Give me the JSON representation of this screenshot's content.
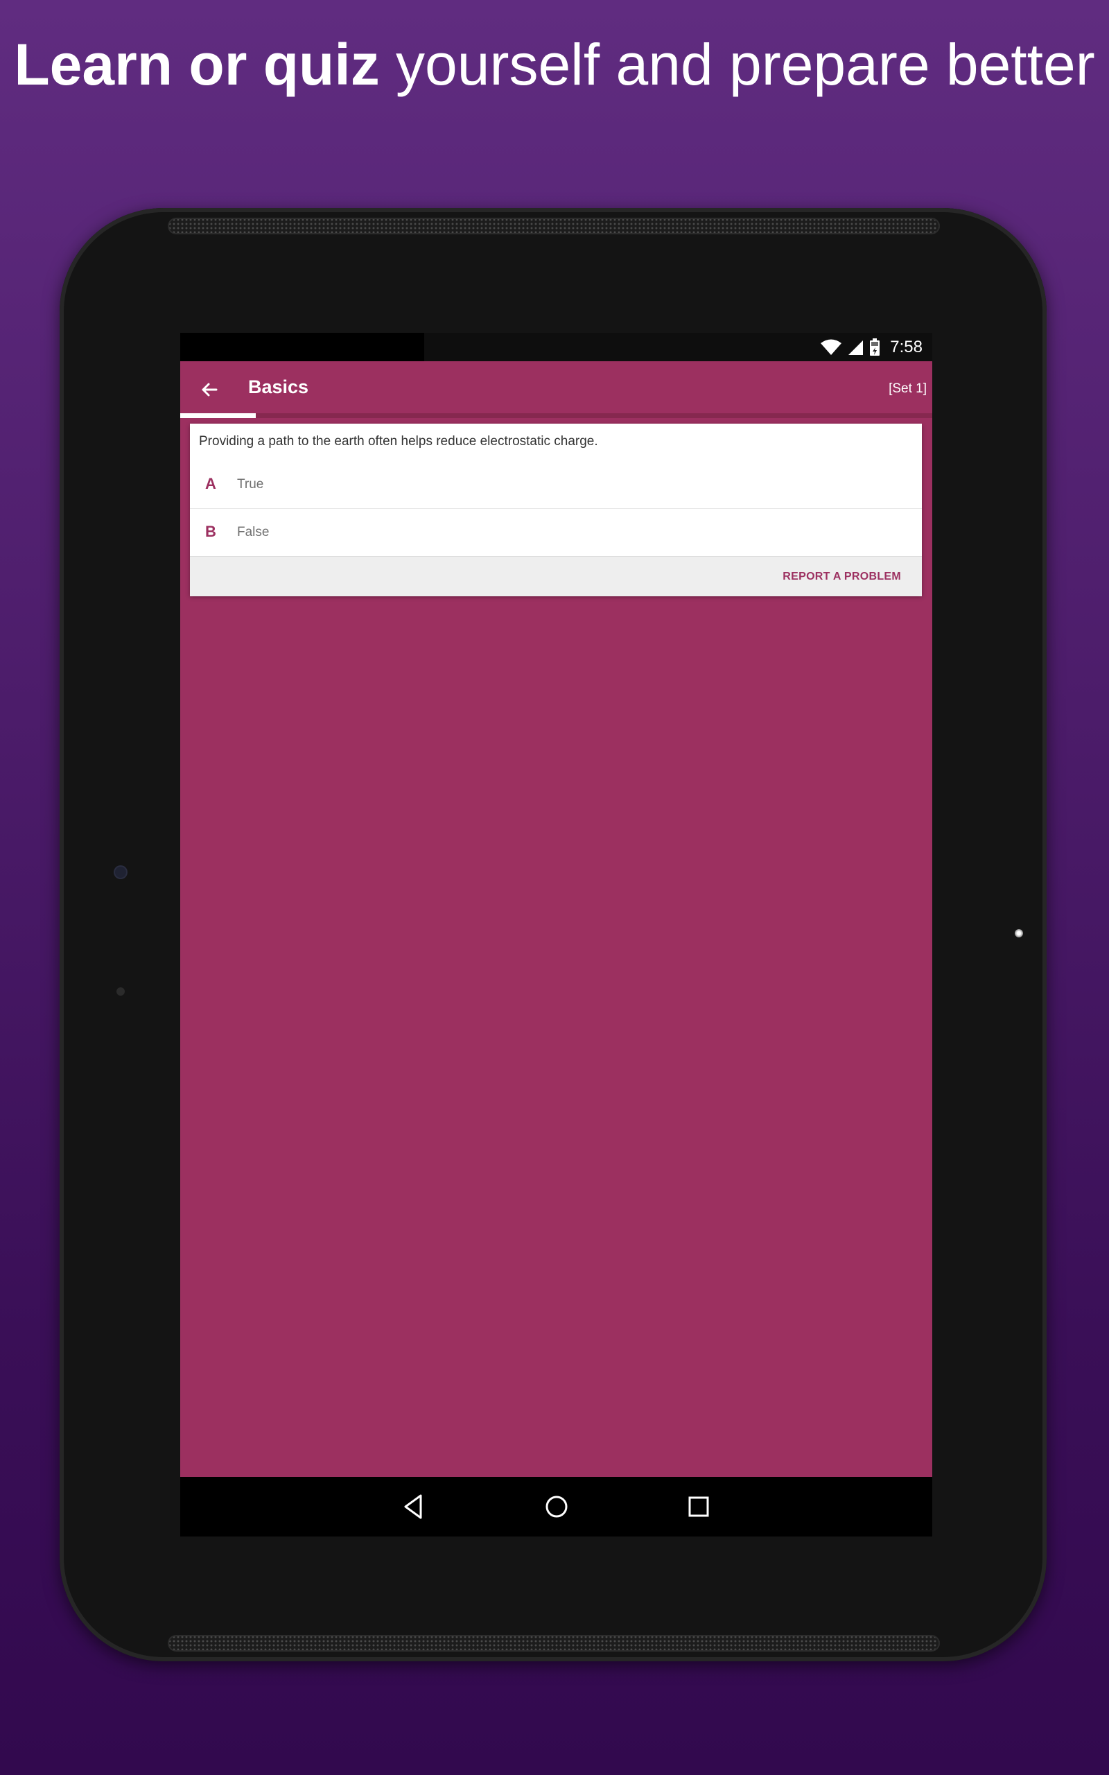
{
  "headline": {
    "bold_text": "Learn or quiz",
    "rest_text": " yourself and prepare better"
  },
  "status_bar": {
    "time": "7:58",
    "icons": [
      "wifi-icon",
      "signal-icon",
      "battery-icon"
    ]
  },
  "app_bar": {
    "title": "Basics",
    "set_label": "[Set 1]",
    "progress_fraction": 0.1
  },
  "question": {
    "text": "Providing a path to the earth often helps reduce electrostatic charge.",
    "options": [
      {
        "letter": "A",
        "text": "True"
      },
      {
        "letter": "B",
        "text": "False"
      }
    ],
    "report_label": "REPORT A PROBLEM"
  },
  "nav_bar": {
    "icons": [
      "nav-back-icon",
      "nav-home-icon",
      "nav-recents-icon"
    ]
  },
  "colors": {
    "background_top": "#602c80",
    "background_bottom": "#32094e",
    "primary": "#9c3060",
    "card": "#ffffff",
    "device": "#141414"
  }
}
